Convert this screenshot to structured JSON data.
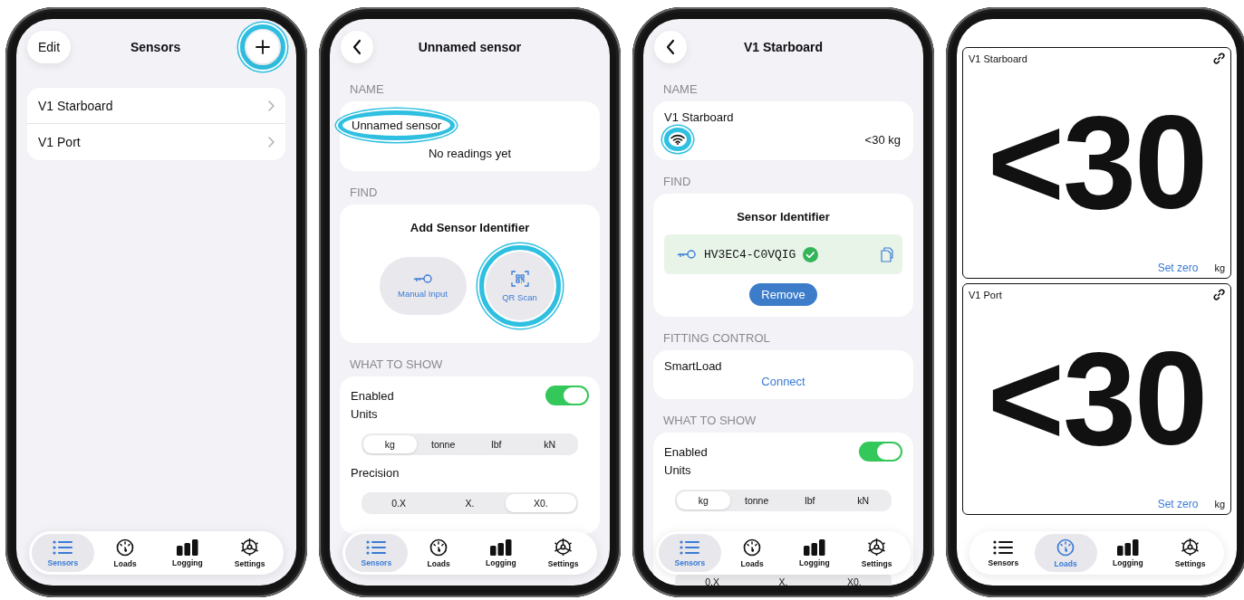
{
  "phones": [
    {
      "kind": "sensor_list",
      "title": "Sensors",
      "edit_label": "Edit",
      "add_highlighted": true,
      "sensors": [
        {
          "name": "V1 Starboard"
        },
        {
          "name": "V1 Port"
        }
      ],
      "tabs": [
        {
          "label": "Sensors",
          "selected": true
        },
        {
          "label": "Loads",
          "selected": false
        },
        {
          "label": "Logging",
          "selected": false
        },
        {
          "label": "Settings",
          "selected": false
        }
      ]
    },
    {
      "kind": "sensor_detail",
      "title": "Unnamed sensor",
      "sections": [
        {
          "kind": "name",
          "header": "NAME",
          "name": "Unnamed sensor",
          "name_highlighted": true,
          "signal": false,
          "reading": "No readings yet"
        },
        {
          "kind": "find_options",
          "header": "FIND",
          "title": "Add Sensor Identifier",
          "options": [
            {
              "label": "Manual Input",
              "highlighted": false
            },
            {
              "label": "QR Scan",
              "highlighted": true
            }
          ]
        },
        {
          "kind": "show",
          "header": "WHAT TO SHOW",
          "enabled_label": "Enabled",
          "enabled": true,
          "units_label": "Units",
          "units": [
            {
              "label": "kg",
              "selected": true
            },
            {
              "label": "tonne",
              "selected": false
            },
            {
              "label": "lbf",
              "selected": false
            },
            {
              "label": "kN",
              "selected": false
            }
          ],
          "precision_label": "Precision",
          "precision": [
            {
              "label": "0.X",
              "selected": false
            },
            {
              "label": "X.",
              "selected": false
            },
            {
              "label": "X0.",
              "selected": true
            }
          ]
        }
      ],
      "tabs": [
        {
          "label": "Sensors",
          "selected": true
        },
        {
          "label": "Loads",
          "selected": false
        },
        {
          "label": "Logging",
          "selected": false
        },
        {
          "label": "Settings",
          "selected": false
        }
      ]
    },
    {
      "kind": "sensor_detail",
      "title": "V1 Starboard",
      "sections": [
        {
          "kind": "name",
          "header": "NAME",
          "name": "V1 Starboard",
          "name_highlighted": false,
          "signal": true,
          "signal_highlighted": true,
          "reading": "<30 kg"
        },
        {
          "kind": "find_identifier",
          "header": "FIND",
          "title": "Sensor Identifier",
          "identifier": "HV3EC4-C0VQIG",
          "verified": true,
          "remove_label": "Remove"
        },
        {
          "kind": "fitting",
          "header": "FITTING CONTROL",
          "label": "SmartLoad",
          "action": "Connect"
        },
        {
          "kind": "show",
          "header": "WHAT TO SHOW",
          "enabled_label": "Enabled",
          "enabled": true,
          "units_label": "Units",
          "units": [
            {
              "label": "kg",
              "selected": true
            },
            {
              "label": "tonne",
              "selected": false
            },
            {
              "label": "lbf",
              "selected": false
            },
            {
              "label": "kN",
              "selected": false
            }
          ],
          "precision": [
            {
              "label": "0.X",
              "selected": false
            },
            {
              "label": "X.",
              "selected": false
            },
            {
              "label": "X0.",
              "selected": false
            }
          ]
        }
      ],
      "tabs": [
        {
          "label": "Sensors",
          "selected": true
        },
        {
          "label": "Loads",
          "selected": false
        },
        {
          "label": "Logging",
          "selected": false
        },
        {
          "label": "Settings",
          "selected": false
        }
      ]
    },
    {
      "kind": "loads",
      "cards": [
        {
          "name": "V1 Starboard",
          "value": "<30",
          "action": "Set zero",
          "unit": "kg"
        },
        {
          "name": "V1 Port",
          "value": "<30",
          "action": "Set zero",
          "unit": "kg"
        }
      ],
      "tabs": [
        {
          "label": "Sensors",
          "selected": false
        },
        {
          "label": "Loads",
          "selected": true
        },
        {
          "label": "Logging",
          "selected": false
        },
        {
          "label": "Settings",
          "selected": false
        }
      ]
    }
  ]
}
